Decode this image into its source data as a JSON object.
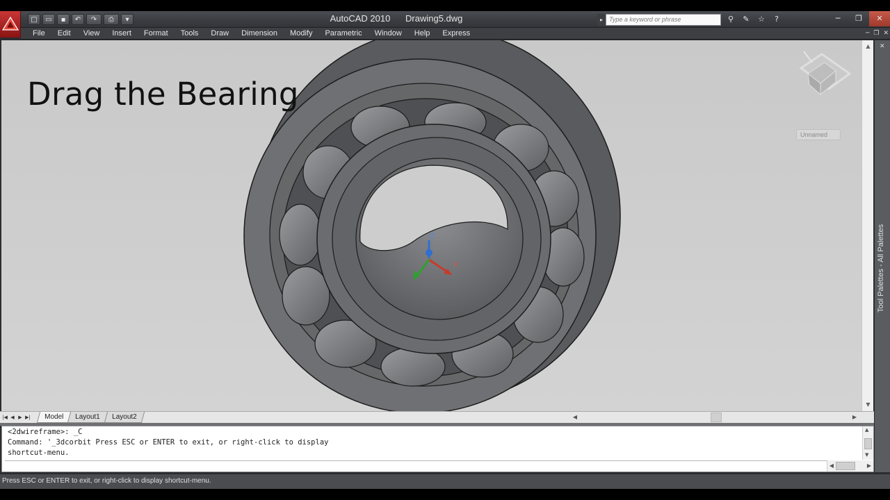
{
  "window": {
    "app_name": "AutoCAD 2010",
    "document": "Drawing5.dwg"
  },
  "quick_access": [
    {
      "icon": "new-file-icon",
      "glyph": "□"
    },
    {
      "icon": "open-folder-icon",
      "glyph": "▭"
    },
    {
      "icon": "save-icon",
      "glyph": "▪"
    },
    {
      "icon": "undo-icon",
      "glyph": "↶"
    },
    {
      "icon": "redo-icon",
      "glyph": "↷"
    },
    {
      "icon": "plot-icon",
      "glyph": "⎙"
    },
    {
      "icon": "dropdown-icon",
      "glyph": "▾"
    }
  ],
  "search": {
    "placeholder": "Type a keyword or phrase"
  },
  "info_tools": [
    {
      "icon": "search-results-icon",
      "glyph": "⚲"
    },
    {
      "icon": "communication-center-icon",
      "glyph": "✎"
    },
    {
      "icon": "favorites-icon",
      "glyph": "☆"
    },
    {
      "icon": "help-icon",
      "glyph": "?"
    }
  ],
  "menu": [
    "File",
    "Edit",
    "View",
    "Insert",
    "Format",
    "Tools",
    "Draw",
    "Dimension",
    "Modify",
    "Parametric",
    "Window",
    "Help",
    "Express"
  ],
  "viewport": {
    "caption": "Drag the Bearing",
    "ucs_menu": "Unnamed",
    "ucs_axes": {
      "z": "Z",
      "x": "X"
    }
  },
  "layout_tabs": [
    "Model",
    "Layout1",
    "Layout2"
  ],
  "active_tab": "Model",
  "command": {
    "lines": [
      "<2dwireframe>: _C",
      "Command: '_3dcorbit Press ESC or ENTER to exit, or right-click to display",
      "shortcut-menu."
    ],
    "input": ""
  },
  "tool_palettes": {
    "label": "Tool Palettes - All Palettes"
  },
  "status": {
    "text": "Press ESC or ENTER to exit, or right-click to display shortcut-menu."
  },
  "colors": {
    "bearing_fill": "#6c6d70",
    "bearing_dark": "#4e4f52",
    "viewport_bg": "#cecece",
    "titlebar": "#3a3c40",
    "z_axis": "#2f6fd0",
    "x_axis": "#c83a2a",
    "y_axis": "#2ea02e"
  }
}
